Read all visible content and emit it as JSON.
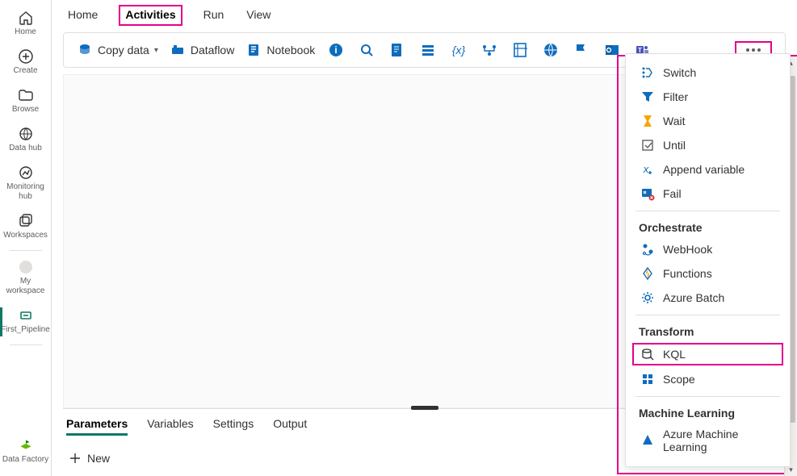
{
  "leftnav": {
    "items": [
      {
        "label": "Home"
      },
      {
        "label": "Create"
      },
      {
        "label": "Browse"
      },
      {
        "label": "Data hub"
      },
      {
        "label": "Monitoring hub"
      },
      {
        "label": "Workspaces"
      },
      {
        "label": "My workspace"
      },
      {
        "label": "First_Pipeline"
      },
      {
        "label": "Data Factory"
      }
    ]
  },
  "tabs": [
    {
      "label": "Home"
    },
    {
      "label": "Activities"
    },
    {
      "label": "Run"
    },
    {
      "label": "View"
    }
  ],
  "toolbar": {
    "copydata": "Copy data",
    "dataflow": "Dataflow",
    "notebook": "Notebook"
  },
  "bottom_tabs": [
    {
      "label": "Parameters"
    },
    {
      "label": "Variables"
    },
    {
      "label": "Settings"
    },
    {
      "label": "Output"
    }
  ],
  "new_label": "New",
  "dropdown": {
    "group1": [
      {
        "label": "Switch"
      },
      {
        "label": "Filter"
      },
      {
        "label": "Wait"
      },
      {
        "label": "Until"
      },
      {
        "label": "Append variable"
      },
      {
        "label": "Fail"
      }
    ],
    "heading2": "Orchestrate",
    "group2": [
      {
        "label": "WebHook"
      },
      {
        "label": "Functions"
      },
      {
        "label": "Azure Batch"
      }
    ],
    "heading3": "Transform",
    "group3": [
      {
        "label": "KQL"
      },
      {
        "label": "Scope"
      }
    ],
    "heading4": "Machine Learning",
    "group4": [
      {
        "label": "Azure Machine Learning"
      }
    ]
  }
}
